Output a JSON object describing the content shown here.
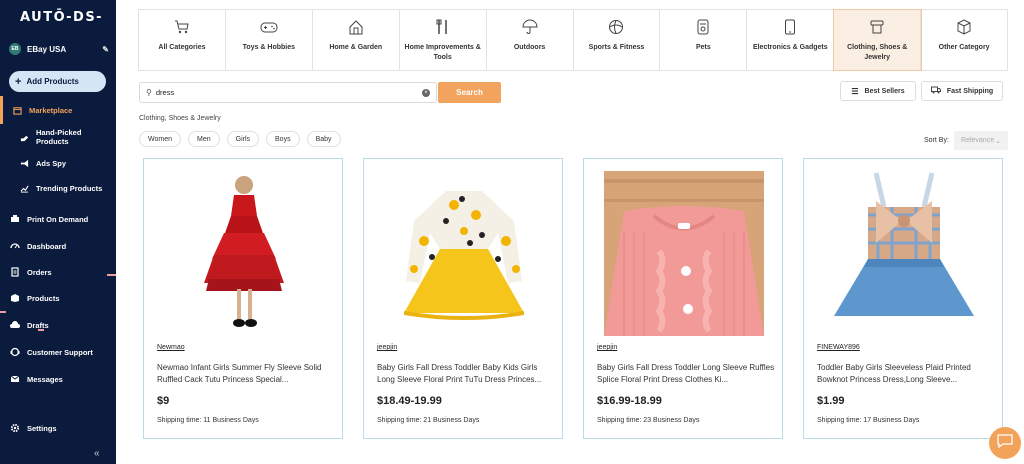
{
  "app": {
    "logo": "AUTŌ-DS-"
  },
  "sidebar": {
    "store_badge": "EB",
    "store_name": "EBay USA",
    "add_products": "Add Products",
    "items": [
      {
        "label": "Marketplace",
        "icon": "store-icon"
      },
      {
        "label": "Hand-Picked Products",
        "icon": "hand-icon"
      },
      {
        "label": "Ads Spy",
        "icon": "megaphone-icon"
      },
      {
        "label": "Trending Products",
        "icon": "trending-icon"
      },
      {
        "label": "Print On Demand",
        "icon": "print-icon"
      },
      {
        "label": "Dashboard",
        "icon": "gauge-icon"
      },
      {
        "label": "Orders",
        "icon": "orders-icon"
      },
      {
        "label": "Products",
        "icon": "box-icon"
      },
      {
        "label": "Drafts",
        "icon": "cloud-icon"
      },
      {
        "label": "Customer Support",
        "icon": "support-icon"
      },
      {
        "label": "Messages",
        "icon": "mail-icon"
      },
      {
        "label": "Settings",
        "icon": "gear-icon"
      }
    ],
    "collapse": "«"
  },
  "categories": [
    {
      "label": "All Categories",
      "icon": "cart-icon"
    },
    {
      "label": "Toys & Hobbies",
      "icon": "gamepad-icon"
    },
    {
      "label": "Home & Garden",
      "icon": "house-icon"
    },
    {
      "label": "Home Improvements & Tools",
      "icon": "tools-icon"
    },
    {
      "label": "Outdoors",
      "icon": "umbrella-icon"
    },
    {
      "label": "Sports & Fitness",
      "icon": "ball-icon"
    },
    {
      "label": "Pets",
      "icon": "pet-icon"
    },
    {
      "label": "Electronics & Gadgets",
      "icon": "phone-icon"
    },
    {
      "label": "Clothing, Shoes & Jewelry",
      "icon": "shirt-icon",
      "selected": true
    },
    {
      "label": "Other Category",
      "icon": "cube-icon"
    }
  ],
  "search": {
    "value": "dress",
    "button": "Search"
  },
  "filters": {
    "best_sellers": "Best Sellers",
    "fast_shipping": "Fast Shipping"
  },
  "breadcrumb": "Clothing, Shoes & Jewelry",
  "chips": [
    "Women",
    "Men",
    "Girls",
    "Boys",
    "Baby"
  ],
  "sort": {
    "label": "Sort By:",
    "value": "Relevance"
  },
  "products": [
    {
      "brand": "Newmao",
      "title": "Newmao Infant Girls Summer Fly Sleeve Solid Ruffled Cack Tutu Princess Special...",
      "price": "$9",
      "shipping": "Shipping time: 11 Business Days"
    },
    {
      "brand": "jeepjin",
      "title": "Baby Girls Fall Dress Toddler Baby Kids Girls Long Sleeve Floral Print TuTu Dress Princes...",
      "price": "$18.49-19.99",
      "shipping": "Shipping time: 21 Business Days"
    },
    {
      "brand": "jeepjin",
      "title": "Baby Girls Fall Dress Toddler Long Sleeve Ruffles Splice Floral Print Dress Clothes Ki...",
      "price": "$16.99-18.99",
      "shipping": "Shipping time: 23 Business Days"
    },
    {
      "brand": "FINEWAY896",
      "title": "Toddler Baby Girls Sleeveless Plaid Printed Bowknot Princess Dress,Long Sleeve...",
      "price": "$1.99",
      "shipping": "Shipping time: 17 Business Days"
    }
  ],
  "colors": {
    "sidebar": "#0b1b3d",
    "accent": "#f2a35e",
    "card_border": "#bcdbe9"
  }
}
